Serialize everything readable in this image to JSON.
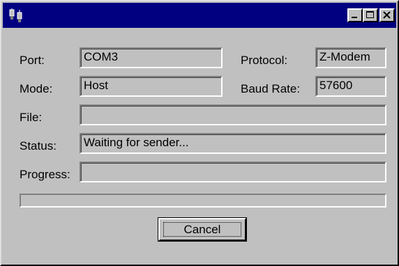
{
  "titlebar": {
    "icon": "serial-connection-icon",
    "buttons": [
      "minimize-icon",
      "maximize-icon",
      "close-icon"
    ]
  },
  "form": {
    "port_label": "Port:",
    "port_value": "COM3",
    "protocol_label": "Protocol:",
    "protocol_value": "Z-Modem",
    "mode_label": "Mode:",
    "mode_value": "Host",
    "baud_label": "Baud Rate:",
    "baud_value": "57600",
    "file_label": "File:",
    "file_value": "",
    "status_label": "Status:",
    "status_value": "Waiting for sender...",
    "progress_label": "Progress:",
    "progress_value": ""
  },
  "progress": {
    "fraction": 0
  },
  "actions": {
    "cancel_label": "Cancel"
  },
  "colors": {
    "titlebar": "#000080",
    "face": "#c0c0c0"
  }
}
